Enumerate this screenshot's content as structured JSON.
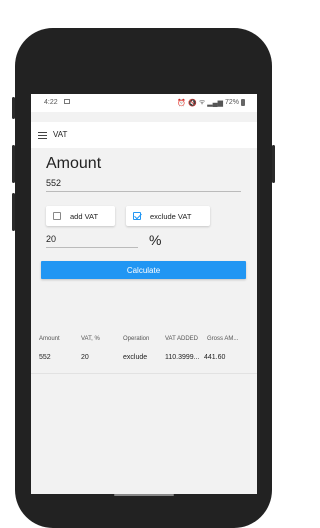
{
  "status_bar": {
    "time": "4:22",
    "battery": "72%",
    "icons": [
      "alarm-icon",
      "mute-icon",
      "wifi-icon",
      "signal-icon",
      "battery-icon"
    ]
  },
  "toolbar": {
    "title": "VAT",
    "menu_icon": "hamburger-menu-icon"
  },
  "amount": {
    "label": "Amount",
    "value": "552"
  },
  "options": {
    "add_vat": {
      "label": "add VAT",
      "checked": false
    },
    "exclude_vat": {
      "label": "exclude VAT",
      "checked": true
    }
  },
  "vat": {
    "value": "20",
    "unit": "%"
  },
  "calculate": {
    "label": "Calculate"
  },
  "table": {
    "headers": [
      "Amount",
      "VAT, %",
      "Operation",
      "VAT ADDED",
      "Gross AM..."
    ],
    "rows": [
      [
        "552",
        "20",
        "exclude",
        "110.3999...",
        "441.60"
      ]
    ]
  },
  "colors": {
    "accent": "#2196f3",
    "background": "#f2f2f2",
    "phone_frame": "#222222"
  }
}
